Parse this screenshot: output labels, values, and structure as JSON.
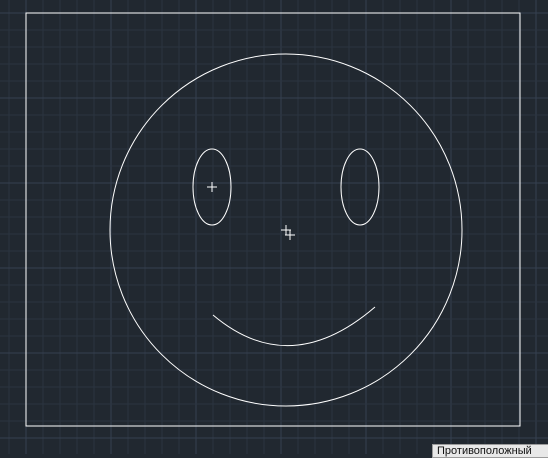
{
  "canvas": {
    "background_color": "#212830",
    "grid_minor_color": "#2b3440",
    "grid_major_color": "#354050",
    "stroke_color": "#ffffff"
  },
  "drawing": {
    "objects": [
      "limits-rectangle",
      "face-circle",
      "left-eye-ellipse",
      "right-eye-ellipse",
      "smile-arc"
    ]
  },
  "cursor": {
    "icon": "crosshair-icon"
  },
  "tooltip": {
    "text": "Противоположный"
  }
}
